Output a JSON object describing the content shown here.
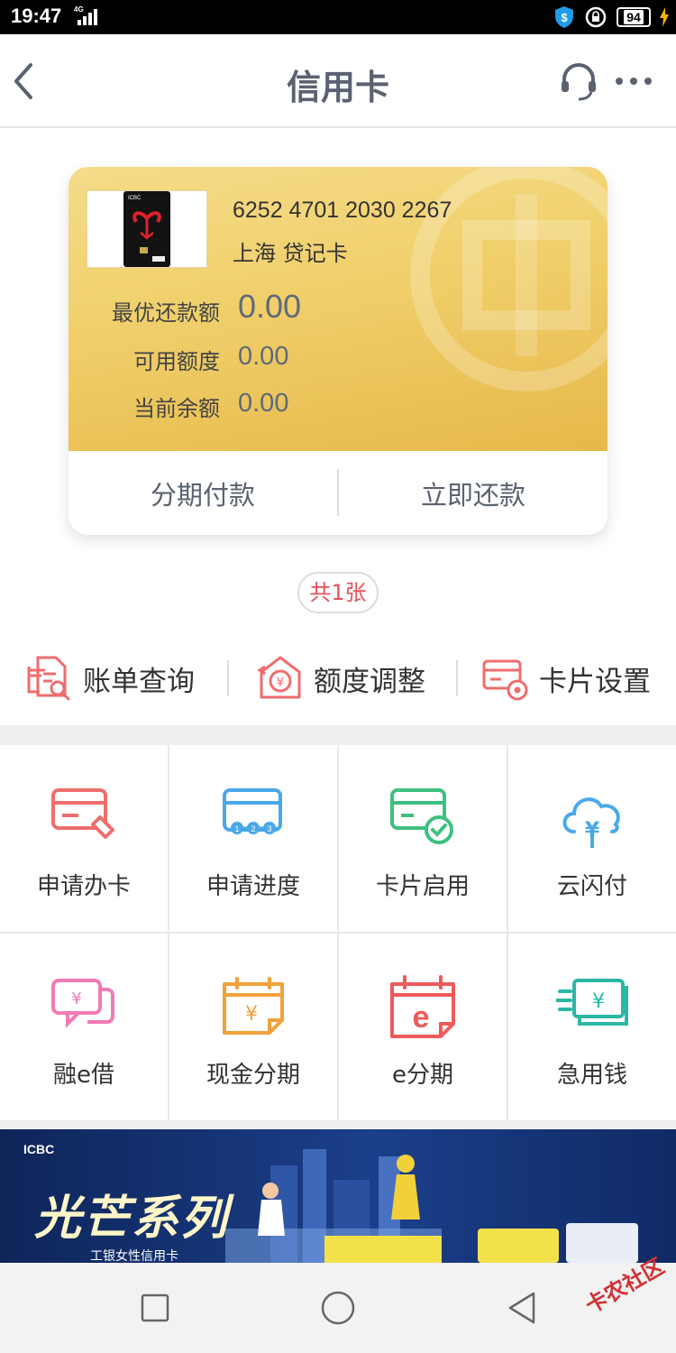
{
  "status_bar": {
    "time": "19:47",
    "network": "4G",
    "battery": "94"
  },
  "nav": {
    "title": "信用卡"
  },
  "card": {
    "number": "6252 4701 2030 2267",
    "desc": "上海 贷记卡",
    "rows": [
      {
        "label": "最优还款额",
        "value": "0.00"
      },
      {
        "label": "可用额度",
        "value": "0.00"
      },
      {
        "label": "当前余额",
        "value": "0.00"
      }
    ],
    "actions": {
      "installment": "分期付款",
      "repay": "立即还款"
    }
  },
  "count_label": "共1张",
  "quick_actions": [
    {
      "label": "账单查询",
      "icon": "bill-search-icon"
    },
    {
      "label": "额度调整",
      "icon": "limit-adjust-icon"
    },
    {
      "label": "卡片设置",
      "icon": "card-settings-icon"
    }
  ],
  "services": [
    {
      "label": "申请办卡",
      "icon": "apply-card-icon"
    },
    {
      "label": "申请进度",
      "icon": "application-progress-icon"
    },
    {
      "label": "卡片启用",
      "icon": "card-activate-icon"
    },
    {
      "label": "云闪付",
      "icon": "cloud-pay-icon"
    },
    {
      "label": "融e借",
      "icon": "loan-icon"
    },
    {
      "label": "现金分期",
      "icon": "cash-installment-icon"
    },
    {
      "label": "e分期",
      "icon": "e-installment-icon"
    },
    {
      "label": "急用钱",
      "icon": "urgent-cash-icon"
    }
  ],
  "banner": {
    "brand": "ICBC",
    "title": "光芒系列",
    "subtitle": "工银女性信用卡"
  },
  "watermark": "卡农社区",
  "colors": {
    "accent": "#ef6d6d",
    "gold": "#f0cf6a",
    "nav_text": "#5a6270"
  }
}
